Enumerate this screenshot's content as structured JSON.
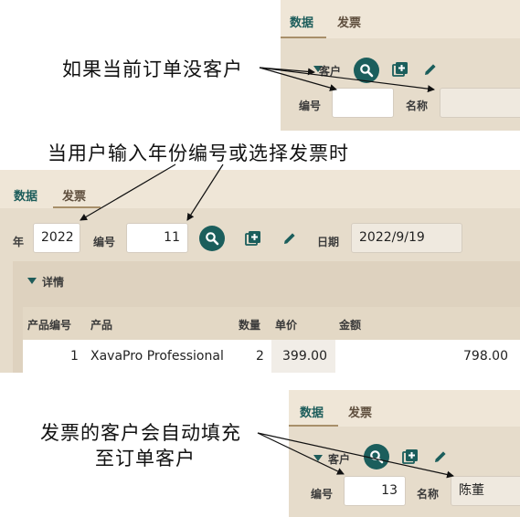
{
  "top": {
    "tabs": [
      {
        "label": "数据"
      },
      {
        "label": "发票"
      }
    ],
    "section_label": "客户",
    "number_label": "编号",
    "name_label": "名称",
    "number_value": "",
    "name_value": ""
  },
  "middle": {
    "tabs": [
      {
        "label": "数据"
      },
      {
        "label": "发票"
      }
    ],
    "year_label": "年",
    "year_value": "2022",
    "number_label": "编号",
    "number_value": "11",
    "date_label": "日期",
    "date_value": "2022/9/19",
    "details_label": "详情",
    "table": {
      "columns": [
        "产品编号",
        "产品",
        "数量",
        "单价",
        "金额"
      ],
      "rows": [
        {
          "id": "1",
          "product": "XavaPro Professional",
          "qty": "2",
          "price": "399.00",
          "amount": "798.00"
        }
      ]
    }
  },
  "bottom": {
    "tabs": [
      {
        "label": "数据"
      },
      {
        "label": "发票"
      }
    ],
    "section_label": "客户",
    "number_label": "编号",
    "number_value": "13",
    "name_label": "名称",
    "name_value": "陈董"
  },
  "annotations": {
    "note1": "如果当前订单没客户",
    "note2": "当用户输入年份编号或选择发票时",
    "note3_line1": "发票的客户会自动填充",
    "note3_line2": "至订单客户"
  },
  "colors": {
    "accent": "#1b5e5c",
    "panel": "#e6dccb",
    "tabbar": "#efe6d7"
  }
}
